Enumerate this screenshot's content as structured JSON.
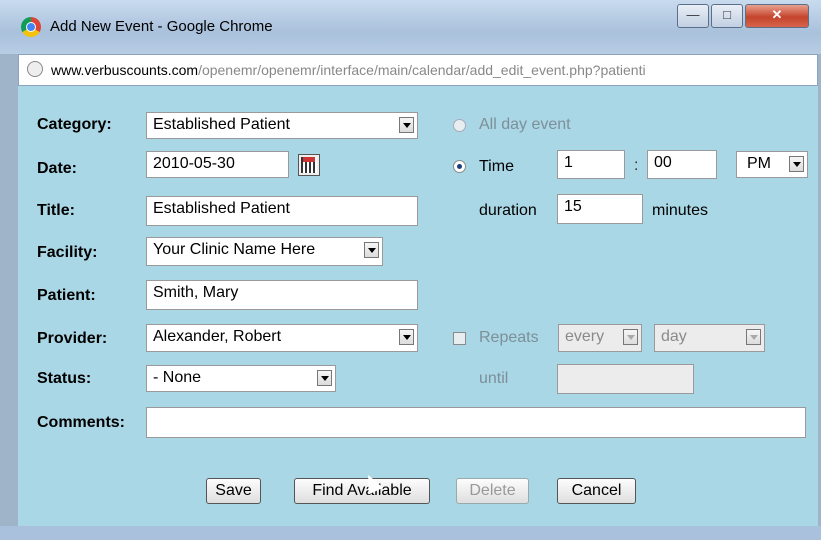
{
  "window": {
    "title": "Add New Event - Google Chrome",
    "minimize_icon": "minimize-icon",
    "maximize_icon": "maximize-icon",
    "close_icon": "close-icon"
  },
  "address": {
    "domain": "www.verbuscounts.com",
    "path": "/openemr/openemr/interface/main/calendar/add_edit_event.php?patienti"
  },
  "form": {
    "category": {
      "label": "Category:",
      "value": "Established Patient"
    },
    "date": {
      "label": "Date:",
      "value": "2010-05-30"
    },
    "title": {
      "label": "Title:",
      "value": "Established Patient"
    },
    "facility": {
      "label": "Facility:",
      "value": "Your Clinic Name Here"
    },
    "patient": {
      "label": "Patient:",
      "value": "Smith, Mary"
    },
    "provider": {
      "label": "Provider:",
      "value": "Alexander, Robert"
    },
    "status": {
      "label": "Status:",
      "value": "- None"
    },
    "comments": {
      "label": "Comments:",
      "value": ""
    },
    "all_day": {
      "label": "All day event"
    },
    "time": {
      "label": "Time",
      "hour": "1",
      "sep": ":",
      "minute": "00",
      "ampm": "PM"
    },
    "duration": {
      "label": "duration",
      "value": "15",
      "unit": "minutes"
    },
    "repeats": {
      "label": "Repeats",
      "every": "every",
      "unit": "day",
      "until_label": "until",
      "until_value": ""
    }
  },
  "buttons": {
    "save": "Save",
    "find_available": "Find Available",
    "delete": "Delete",
    "cancel": "Cancel"
  }
}
